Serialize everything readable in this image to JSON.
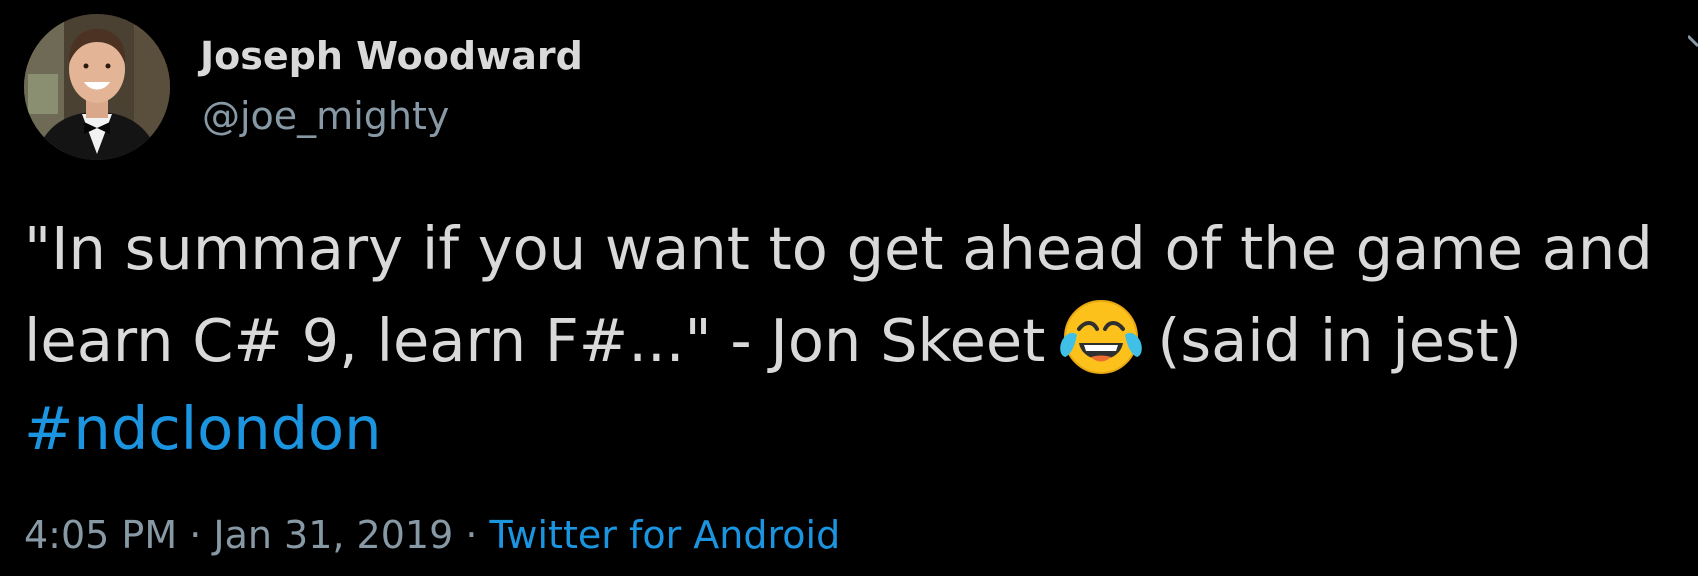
{
  "author": {
    "display_name": "Joseph Woodward",
    "handle": "@joe_mighty"
  },
  "tweet": {
    "line1": "\"In summary if you want to get ahead of the game and",
    "line2_before_emoji": "learn C# 9, learn F#...\" - Jon Skeet",
    "emoji": "face-with-tears-of-joy-icon",
    "line2_after_emoji": "(said in jest)",
    "hashtag": "#ndclondon"
  },
  "meta": {
    "time": "4:05 PM",
    "separator1": " · ",
    "date": "Jan 31, 2019",
    "separator2": " · ",
    "source": "Twitter for Android"
  },
  "colors": {
    "background": "#000000",
    "text": "#d9d9d9",
    "muted": "#8899a6",
    "link": "#1b95e0"
  }
}
